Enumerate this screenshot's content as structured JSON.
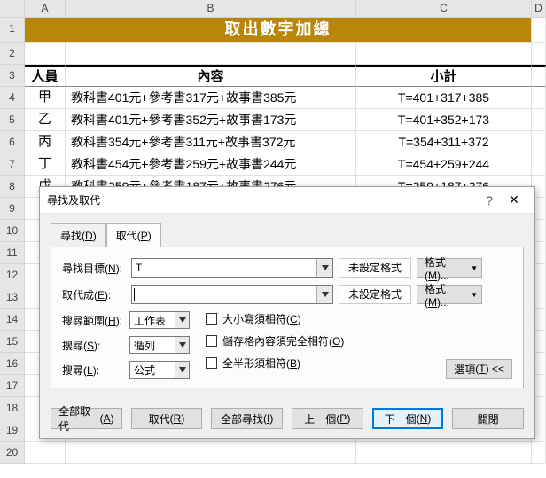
{
  "columns": {
    "A": "A",
    "B": "B",
    "C": "C",
    "D": "D"
  },
  "rownums": [
    "1",
    "2",
    "3",
    "4",
    "5",
    "6",
    "7",
    "8",
    "9",
    "10",
    "11",
    "12",
    "13",
    "14",
    "15",
    "16",
    "17",
    "18",
    "19",
    "20"
  ],
  "title": "取出數字加總",
  "headers": {
    "A": "人員",
    "B": "內容",
    "C": "小計"
  },
  "rows": [
    {
      "A": "甲",
      "B": "教科書401元+參考書317元+故事書385元",
      "C": "T=401+317+385"
    },
    {
      "A": "乙",
      "B": "教科書401元+參考書352元+故事書173元",
      "C": "T=401+352+173"
    },
    {
      "A": "丙",
      "B": "教科書354元+參考書311元+故事書372元",
      "C": "T=354+311+372"
    },
    {
      "A": "丁",
      "B": "教科書454元+參考書259元+故事書244元",
      "C": "T=454+259+244"
    },
    {
      "A": "戊",
      "B": "教科書259元+參考書187元+故事書276元",
      "C": "T=259+187+276"
    }
  ],
  "dialog": {
    "title": "尋找及取代",
    "help": "?",
    "close": "✕",
    "tabs": {
      "find": "尋找",
      "find_u": "D",
      "replace": "取代",
      "replace_u": "P"
    },
    "find_label": "尋找目標",
    "find_u": "N",
    "find_value": "T",
    "repl_label": "取代成",
    "repl_u": "E",
    "repl_value": "",
    "no_format": "未設定格式",
    "format_btn": "格式",
    "format_u": "M",
    "within_label": "搜尋範圍",
    "within_u": "H",
    "within_value": "工作表",
    "search_label": "搜尋",
    "search_u": "S",
    "search_value": "循列",
    "lookin_label": "搜尋",
    "lookin_u": "L",
    "lookin_value": "公式",
    "chk_case": "大小寫須相符",
    "chk_case_u": "C",
    "chk_whole": "儲存格內容須完全相符",
    "chk_whole_u": "O",
    "chk_byte": "全半形須相符",
    "chk_byte_u": "B",
    "options_btn": "選項",
    "options_u": "T",
    "options_arrow": "<<",
    "btn_replace_all": "全部取代",
    "btn_replace_all_u": "A",
    "btn_replace": "取代",
    "btn_replace_u": "R",
    "btn_find_all": "全部尋找",
    "btn_find_all_u": "I",
    "btn_prev": "上一個",
    "btn_prev_u": "P",
    "btn_next": "下一個",
    "btn_next_u": "N",
    "btn_close": "關閉"
  }
}
